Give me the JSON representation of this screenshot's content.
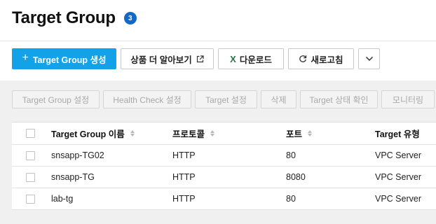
{
  "header": {
    "title": "Target Group",
    "count": "3"
  },
  "toolbar": {
    "create_label": "Target Group 생성",
    "learn_label": "상품 더 알아보기",
    "download_label": "다운로드",
    "refresh_label": "새로고침"
  },
  "actions": [
    {
      "label": "Target Group 설정"
    },
    {
      "label": "Health Check 설정"
    },
    {
      "label": "Target 설정"
    },
    {
      "label": "삭제"
    },
    {
      "label": "Target 상태 확인"
    },
    {
      "label": "모니터링"
    }
  ],
  "table": {
    "columns": [
      "Target Group 이름",
      "프로토콜",
      "포트",
      "Target 유형"
    ],
    "rows": [
      {
        "name": "snsapp-TG02",
        "protocol": "HTTP",
        "port": "80",
        "type": "VPC Server"
      },
      {
        "name": "snsapp-TG",
        "protocol": "HTTP",
        "port": "8080",
        "type": "VPC Server"
      },
      {
        "name": "lab-tg",
        "protocol": "HTTP",
        "port": "80",
        "type": "VPC Server"
      }
    ]
  },
  "colors": {
    "primary": "#13a2e8",
    "badge": "#1568c5",
    "excel_green": "#1d7a3e"
  }
}
